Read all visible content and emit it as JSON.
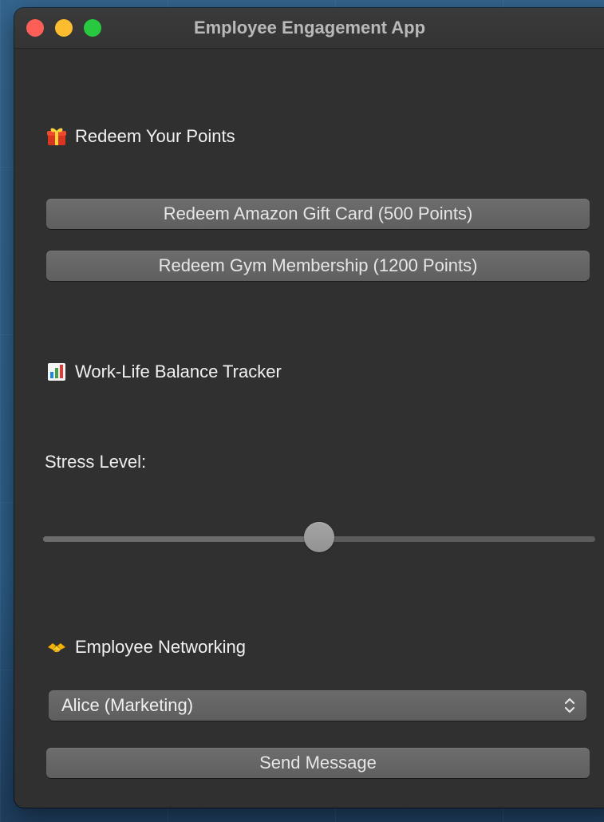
{
  "window": {
    "title": "Employee Engagement App"
  },
  "redeem": {
    "heading": "Redeem Your Points",
    "amazon_button": "Redeem Amazon Gift Card (500 Points)",
    "gym_button": "Redeem Gym Membership (1200 Points)",
    "icon": "gift-icon"
  },
  "balance": {
    "heading": "Work-Life Balance Tracker",
    "icon": "bar-chart-icon",
    "stress_label": "Stress Level:",
    "slider_value_percent": 50
  },
  "networking": {
    "heading": "Employee Networking",
    "icon": "handshake-icon",
    "selected_contact": "Alice (Marketing)",
    "send_button": "Send Message"
  },
  "colors": {
    "window_bg": "#303030",
    "button_bg": "#666666",
    "text": "#f0f0f0",
    "traffic_red": "#ff5f57",
    "traffic_yellow": "#febc2e",
    "traffic_green": "#28c840"
  }
}
